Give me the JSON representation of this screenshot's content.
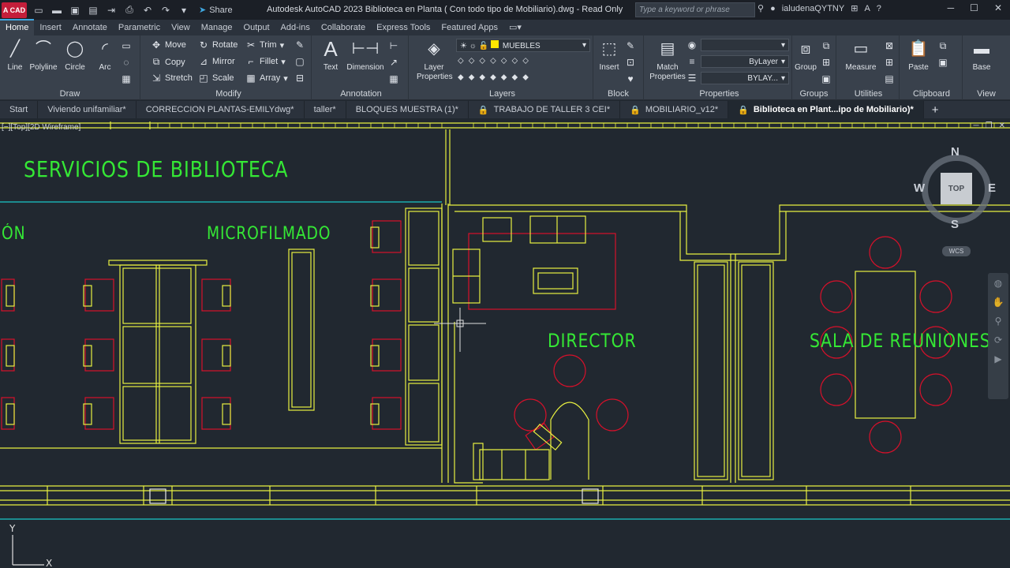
{
  "app": {
    "logo": "A CAD",
    "title": "Autodesk AutoCAD 2023    Biblioteca en Planta ( Con todo tipo de Mobiliario).dwg - Read Only",
    "share": "Share",
    "search_placeholder": "Type a keyword or phrase",
    "user": "ialudenaQYTNY",
    "help": "?"
  },
  "ribbon_tabs": [
    "Home",
    "Insert",
    "Annotate",
    "Parametric",
    "View",
    "Manage",
    "Output",
    "Add-ins",
    "Collaborate",
    "Express Tools",
    "Featured Apps"
  ],
  "draw": {
    "title": "Draw",
    "line": "Line",
    "polyline": "Polyline",
    "circle": "Circle",
    "arc": "Arc"
  },
  "modify": {
    "title": "Modify",
    "move": "Move",
    "rotate": "Rotate",
    "trim": "Trim",
    "copy": "Copy",
    "mirror": "Mirror",
    "fillet": "Fillet",
    "stretch": "Stretch",
    "scale": "Scale",
    "array": "Array"
  },
  "annotation": {
    "title": "Annotation",
    "text": "Text",
    "dimension": "Dimension"
  },
  "layers": {
    "title": "Layers",
    "layer_properties": "Layer Properties",
    "current_layer": "MUEBLES"
  },
  "block": {
    "title": "Block",
    "insert": "Insert"
  },
  "properties": {
    "title": "Properties",
    "match": "Match Properties",
    "linetype": "ByLayer",
    "lineweight": "BYLAY..."
  },
  "groups": {
    "title": "Groups",
    "group": "Group"
  },
  "utilities": {
    "title": "Utilities",
    "measure": "Measure"
  },
  "clipboard": {
    "title": "Clipboard",
    "paste": "Paste"
  },
  "view": {
    "title": "View",
    "base": "Base"
  },
  "file_tabs": [
    "Start",
    "Viviendo unifamiliar*",
    "CORRECCION PLANTAS-EMILYdwg*",
    "taller*",
    "BLOQUES MUESTRA (1)*",
    "TRABAJO DE TALLER 3 CEI*",
    "MOBILIARIO_v12*",
    "Biblioteca en Plant...ipo de Mobiliario)*"
  ],
  "viewport": {
    "control": "[−][Top][2D Wireframe]"
  },
  "drawing_labels": {
    "servicios": "SERVICIOS DE BIBLIOTECA",
    "on": "ÓN",
    "microfilmado": "MICROFILMADO",
    "director": "DIRECTOR",
    "sala": "SALA DE REUNIONES"
  },
  "viewcube": {
    "n": "N",
    "s": "S",
    "e": "E",
    "w": "W",
    "top": "TOP",
    "wcs": "WCS"
  },
  "ucs": {
    "x": "X",
    "y": "Y"
  },
  "colors": {
    "cad_yellow": "#e8f040",
    "cad_red": "#d8102a",
    "cad_green": "#35e835",
    "cad_cyan": "#19c6c6",
    "background": "#212830"
  }
}
